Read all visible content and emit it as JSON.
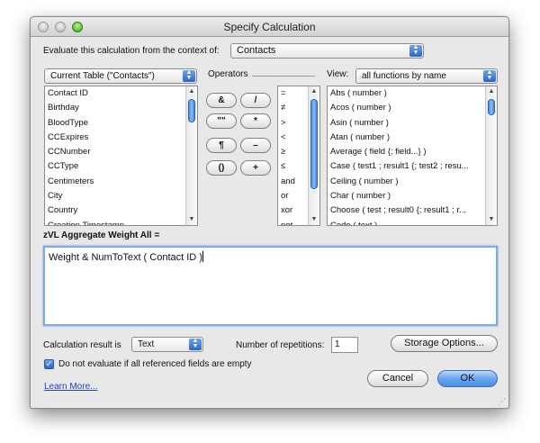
{
  "window": {
    "title": "Specify Calculation"
  },
  "context": {
    "label": "Evaluate this calculation from the context of:",
    "value": "Contacts"
  },
  "fields": {
    "table_popup": "Current Table (\"Contacts\")",
    "items": [
      "Contact ID",
      "Birthday",
      "BloodType",
      "CCExpires",
      "CCNumber",
      "CCType",
      "Centimeters",
      "City",
      "Country",
      "Creation Timestamp"
    ]
  },
  "operators": {
    "label": "Operators",
    "buttons": [
      "&",
      "/",
      "\"\"",
      "*",
      "¶",
      "–",
      "()",
      "+"
    ],
    "list": [
      "=",
      "≠",
      ">",
      "<",
      "≥",
      "≤",
      "and",
      "or",
      "xor",
      "not"
    ]
  },
  "functions": {
    "view_label": "View:",
    "view_value": "all functions by name",
    "items": [
      "Abs ( number )",
      "Acos ( number )",
      "Asin ( number )",
      "Atan ( number )",
      "Average ( field {; field...} )",
      "Case ( test1 ; result1 {; test2 ; resu...",
      "Ceiling ( number )",
      "Char ( number )",
      "Choose ( test ; result0 {; result1 ; r...",
      "Code ( text )"
    ]
  },
  "calc": {
    "field_label": "zVL Aggregate Weight All =",
    "expression": "Weight & NumToText ( Contact ID )"
  },
  "result": {
    "label": "Calculation result is",
    "value": "Text"
  },
  "repetitions": {
    "label": "Number of repetitions:",
    "value": "1"
  },
  "storage_button": "Storage Options...",
  "do_not_evaluate": {
    "label": "Do not evaluate if all referenced fields are empty",
    "checked": true
  },
  "learn_more": "Learn More...",
  "cancel_button": "Cancel",
  "ok_button": "OK"
}
